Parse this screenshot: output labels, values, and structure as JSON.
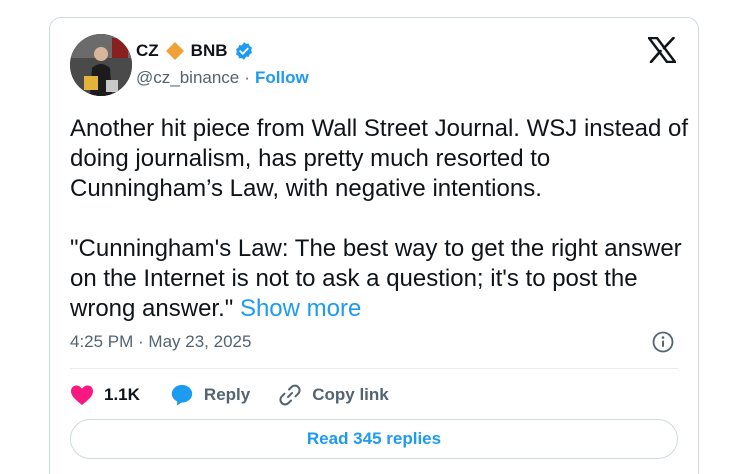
{
  "author": {
    "name": "CZ",
    "name_suffix": "BNB",
    "handle": "@cz_binance",
    "separator": "·",
    "follow_label": "Follow"
  },
  "tweet": {
    "text": "Another hit piece from Wall Street Journal. WSJ instead of doing journalism, has pretty much resorted to Cunningham’s Law, with negative intentions.\n\n\"Cunningham's Law: The best way to get the right answer on the Internet is not to ask a question; it's to post the wrong answer.\" ",
    "show_more_label": "Show more",
    "timestamp": "4:25 PM · May 23, 2025"
  },
  "actions": {
    "likes_count": "1.1K",
    "reply_label": "Reply",
    "copy_link_label": "Copy link"
  },
  "replies_button_label": "Read 345 replies",
  "colors": {
    "accent": "#1d9bf0",
    "like": "#f91880",
    "diamond": "#f0a135",
    "text_primary": "#0f1419",
    "text_secondary": "#536471"
  },
  "icons": {
    "brand": "x-logo-icon",
    "badge": "bnb-diamond-icon",
    "verified": "verified-badge-icon",
    "info": "info-icon",
    "like": "heart-icon",
    "reply": "reply-bubble-icon",
    "copy": "link-icon"
  }
}
